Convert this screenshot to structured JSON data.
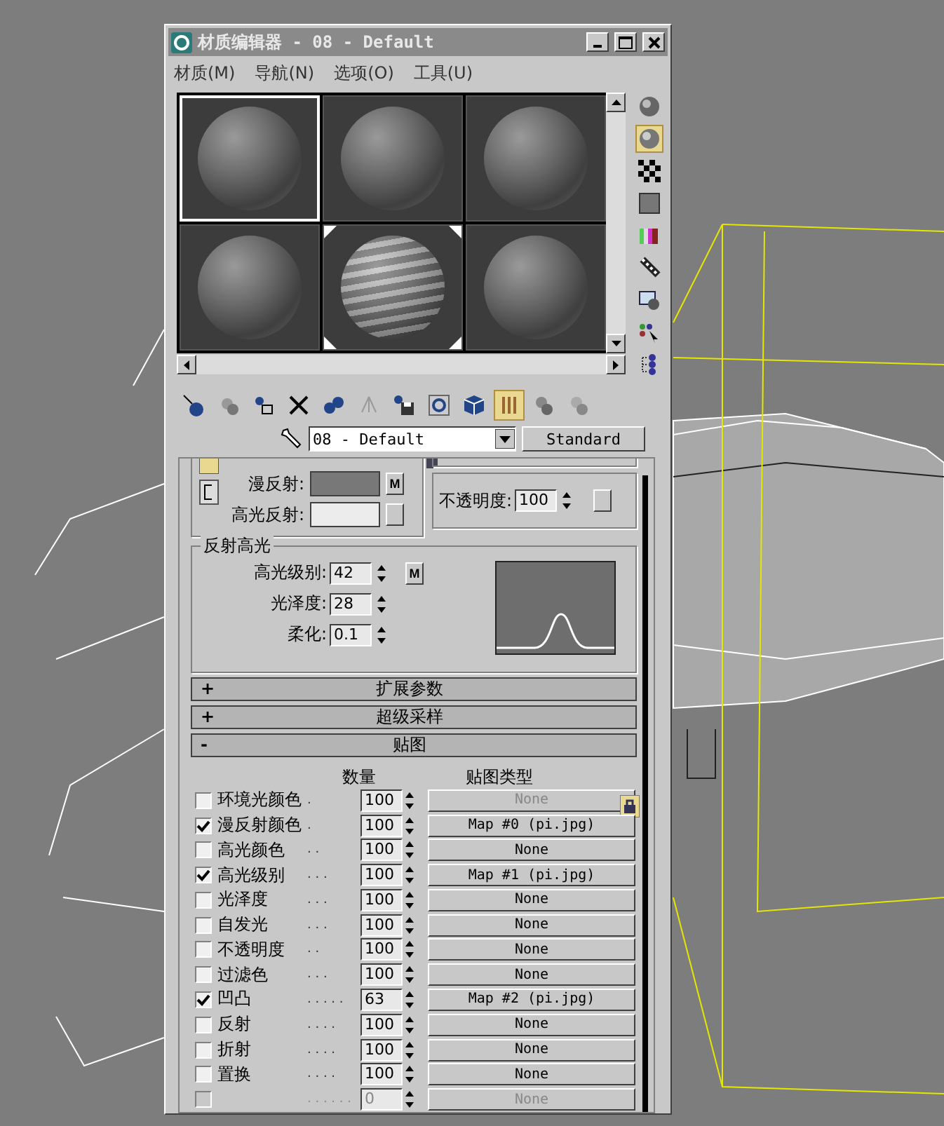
{
  "window": {
    "title": "材质编辑器 - 08 - Default"
  },
  "menu": [
    {
      "label": "材质(M)"
    },
    {
      "label": "导航(N)"
    },
    {
      "label": "选项(O)"
    },
    {
      "label": "工具(U)"
    }
  ],
  "sample_slots": [
    {
      "kind": "plain",
      "selected": true,
      "hot": false
    },
    {
      "kind": "plain",
      "selected": false,
      "hot": false
    },
    {
      "kind": "plain",
      "selected": false,
      "hot": false
    },
    {
      "kind": "plain",
      "selected": false,
      "hot": false
    },
    {
      "kind": "textured",
      "selected": false,
      "hot": true
    },
    {
      "kind": "plain",
      "selected": false,
      "hot": false
    }
  ],
  "side_tools": [
    {
      "selected": false
    },
    {
      "selected": true
    },
    {
      "selected": false
    },
    {
      "selected": false
    },
    {
      "selected": false
    },
    {
      "selected": false
    },
    {
      "selected": false
    },
    {
      "selected": false
    },
    {
      "selected": false
    }
  ],
  "toolbar": [
    {
      "selected": false
    },
    {
      "selected": false
    },
    {
      "selected": false
    },
    {
      "selected": false
    },
    {
      "selected": false
    },
    {
      "selected": false
    },
    {
      "selected": false
    },
    {
      "selected": false
    },
    {
      "selected": false
    },
    {
      "selected": true
    },
    {
      "selected": false
    },
    {
      "selected": false
    }
  ],
  "material_name": "08 - Default",
  "material_type": "Standard",
  "basic": {
    "diffuse_label": "漫反射:",
    "diffuse_map_button": "M",
    "specular_label": "高光反射:",
    "opacity_label": "不透明度:",
    "opacity_value": "100"
  },
  "specular_highlights": {
    "title": "反射高光",
    "fields": [
      {
        "label": "高光级别:",
        "value": "42",
        "map_button": "M"
      },
      {
        "label": "光泽度:",
        "value": "28"
      },
      {
        "label": "柔化:",
        "value": "0.1"
      }
    ]
  },
  "rollouts": [
    {
      "sign": "+",
      "title": "扩展参数"
    },
    {
      "sign": "+",
      "title": "超级采样"
    },
    {
      "sign": "-",
      "title": "贴图"
    }
  ],
  "maps": {
    "amount_header": "数量",
    "type_header": "贴图类型",
    "rows": [
      {
        "label": "环境光颜色",
        "leader": ".",
        "checked": false,
        "amount": "100",
        "map": "None",
        "disabled": false,
        "map_disabled": true
      },
      {
        "label": "漫反射颜色",
        "leader": ".",
        "checked": true,
        "amount": "100",
        "map": "Map #0 (pi.jpg)",
        "disabled": false,
        "map_disabled": false
      },
      {
        "label": "高光颜色",
        "leader": ". .",
        "checked": false,
        "amount": "100",
        "map": "None",
        "disabled": false,
        "map_disabled": false
      },
      {
        "label": "高光级别",
        "leader": ". . .",
        "checked": true,
        "amount": "100",
        "map": "Map #1 (pi.jpg)",
        "disabled": false,
        "map_disabled": false
      },
      {
        "label": "光泽度",
        "leader": ". . .",
        "checked": false,
        "amount": "100",
        "map": "None",
        "disabled": false,
        "map_disabled": false
      },
      {
        "label": "自发光",
        "leader": ". . .",
        "checked": false,
        "amount": "100",
        "map": "None",
        "disabled": false,
        "map_disabled": false
      },
      {
        "label": "不透明度",
        "leader": ". .",
        "checked": false,
        "amount": "100",
        "map": "None",
        "disabled": false,
        "map_disabled": false
      },
      {
        "label": "过滤色",
        "leader": ". . .",
        "checked": false,
        "amount": "100",
        "map": "None",
        "disabled": false,
        "map_disabled": false
      },
      {
        "label": "凹凸",
        "leader": ". . . . .",
        "checked": true,
        "amount": "63",
        "map": "Map #2 (pi.jpg)",
        "disabled": false,
        "map_disabled": false
      },
      {
        "label": "反射",
        "leader": ". . . .",
        "checked": false,
        "amount": "100",
        "map": "None",
        "disabled": false,
        "map_disabled": false
      },
      {
        "label": "折射",
        "leader": ". . . .",
        "checked": false,
        "amount": "100",
        "map": "None",
        "disabled": false,
        "map_disabled": false
      },
      {
        "label": "置换",
        "leader": ". . . .",
        "checked": false,
        "amount": "100",
        "map": "None",
        "disabled": false,
        "map_disabled": false
      },
      {
        "leader": ". . . . . .",
        "checked": false,
        "amount": "0",
        "map": "None",
        "disabled": true,
        "map_disabled": true
      }
    ]
  }
}
